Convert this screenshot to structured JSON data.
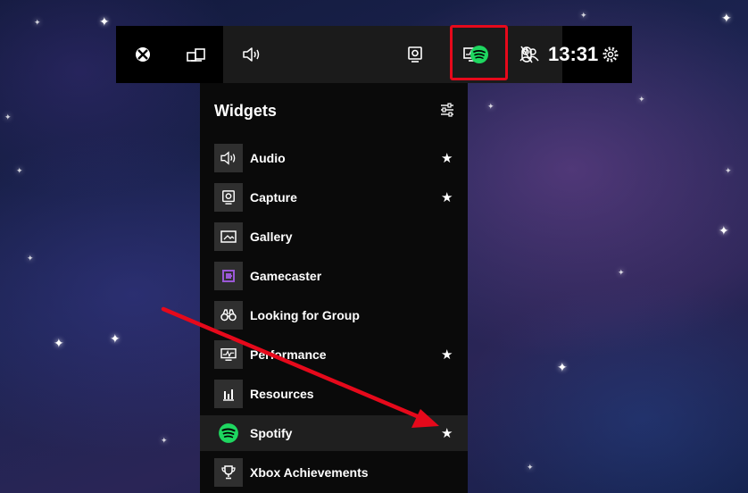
{
  "topbar": {
    "icons": [
      "xbox-icon",
      "widget-menu-icon",
      "audio-icon",
      "capture-icon",
      "performance-icon",
      "social-icon",
      "spotify-icon",
      "mouse-icon",
      "gear-icon"
    ],
    "clock": "13:31",
    "spotify_color": "#1ed760",
    "highlight_color": "#e6091b"
  },
  "panel": {
    "title": "Widgets",
    "items": [
      {
        "label": "Audio",
        "icon": "audio-icon",
        "favorite": true
      },
      {
        "label": "Capture",
        "icon": "capture-icon",
        "favorite": true
      },
      {
        "label": "Gallery",
        "icon": "gallery-icon",
        "favorite": false
      },
      {
        "label": "Gamecaster",
        "icon": "gamecaster-icon",
        "favorite": false
      },
      {
        "label": "Looking for Group",
        "icon": "binoculars-icon",
        "favorite": false
      },
      {
        "label": "Performance",
        "icon": "performance-icon",
        "favorite": true
      },
      {
        "label": "Resources",
        "icon": "resources-icon",
        "favorite": false
      },
      {
        "label": "Spotify",
        "icon": "spotify-icon",
        "favorite": true
      },
      {
        "label": "Xbox Achievements",
        "icon": "trophy-icon",
        "favorite": false
      }
    ]
  },
  "star_glyph": "★",
  "annotation_arrow_color": "#e6091b"
}
